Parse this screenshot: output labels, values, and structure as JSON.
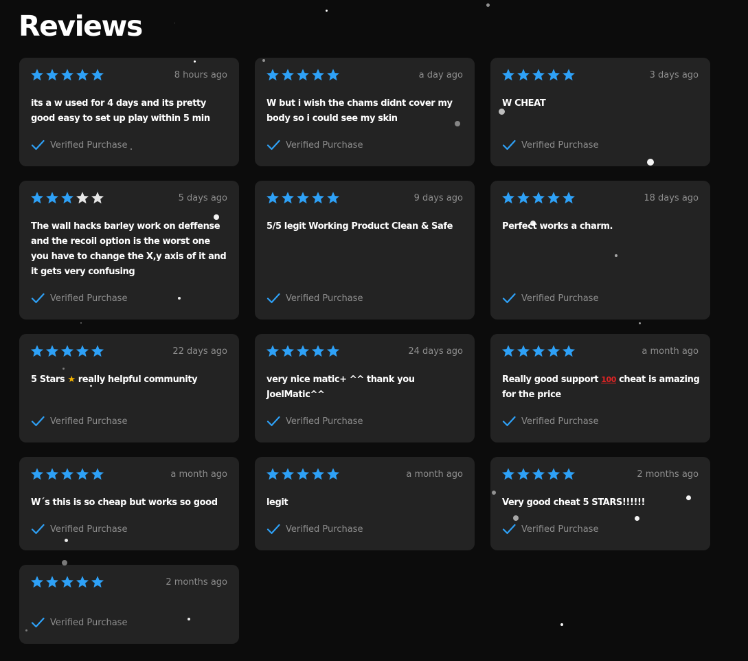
{
  "page": {
    "title": "Reviews"
  },
  "colors": {
    "star_filled": "#2ea1f7",
    "star_empty": "#e6e6e6",
    "check": "#2ea1f7",
    "card_bg": "#232323",
    "page_bg": "#0c0c0c"
  },
  "reviews": [
    {
      "rating": 5,
      "time": "8 hours ago",
      "text": "its a w used for 4 days and its pretty good easy to set up play within 5 min",
      "verified": "Verified Purchase"
    },
    {
      "rating": 5,
      "time": "a day ago",
      "text": "W but i wish the chams didnt cover my body so i could see my skin",
      "verified": "Verified Purchase"
    },
    {
      "rating": 5,
      "time": "3 days ago",
      "text": "W CHEAT",
      "verified": "Verified Purchase"
    },
    {
      "rating": 3,
      "time": "5 days ago",
      "text": "The wall hacks barley work on deffense and the recoil option is the worst one you have to change the X,y axis of it and it gets very confusing",
      "verified": "Verified Purchase"
    },
    {
      "rating": 5,
      "time": "9 days ago",
      "text": "5/5 legit Working Product Clean & Safe",
      "verified": "Verified Purchase"
    },
    {
      "rating": 5,
      "time": "18 days ago",
      "text": "Perfect works a charm.",
      "verified": "Verified Purchase"
    },
    {
      "rating": 5,
      "time": "22 days ago",
      "text_before": "5 Stars ",
      "emoji": "★",
      "text_after": " really helpful community",
      "verified": "Verified Purchase"
    },
    {
      "rating": 5,
      "time": "24 days ago",
      "text": "very nice matic+ ^^ thank you JoelMatic^^",
      "verified": "Verified Purchase"
    },
    {
      "rating": 5,
      "time": "a month ago",
      "text_before": "Really good support ",
      "emoji": "100",
      "text_after": " cheat is amazing for the price",
      "verified": "Verified Purchase"
    },
    {
      "rating": 5,
      "time": "a month ago",
      "text": "W´s this is so cheap but works so good",
      "verified": "Verified Purchase"
    },
    {
      "rating": 5,
      "time": "a month ago",
      "text": "legit",
      "verified": "Verified Purchase"
    },
    {
      "rating": 5,
      "time": "2 months ago",
      "text": "Very good cheat 5 STARS!!!!!!",
      "verified": "Verified Purchase"
    },
    {
      "rating": 5,
      "time": "2 months ago",
      "text": "",
      "verified": "Verified Purchase"
    }
  ]
}
